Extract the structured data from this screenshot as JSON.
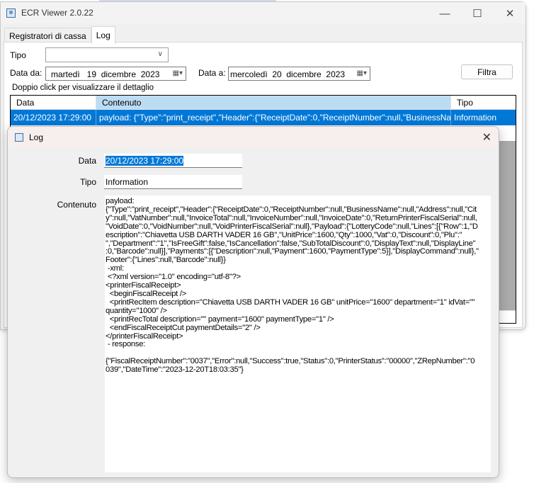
{
  "window": {
    "title": "ECR Viewer 2.0.22",
    "minimize": "—",
    "maximize": "☐",
    "close": "✕"
  },
  "tabs": [
    {
      "label": "Registratori di cassa"
    },
    {
      "label": "Log"
    }
  ],
  "filters": {
    "tipo_label": "Tipo",
    "tipo_value": "",
    "data_da_label": "Data da:",
    "data_da_value": "martedì   19  dicembre  2023",
    "data_a_label": "Data a:",
    "data_a_value": "mercoledì  20  dicembre  2023",
    "filter_button": "Filtra",
    "hint": "Doppio click per visualizzare il dettaglio"
  },
  "grid": {
    "columns": [
      "Data",
      "Contenuto",
      "Tipo"
    ],
    "rows": [
      {
        "data": "20/12/2023 17:29:00",
        "contenuto": "payload: {\"Type\":\"print_receipt\",\"Header\":{\"ReceiptDate\":0,\"ReceiptNumber\":null,\"BusinessName\":...",
        "tipo": "Information"
      }
    ]
  },
  "dialog": {
    "title": "Log",
    "close": "✕",
    "data_label": "Data",
    "data_value": "20/12/2023 17:29:00",
    "tipo_label": "Tipo",
    "tipo_value": "Information",
    "contenuto_label": "Contenuto",
    "contenuto_lines": [
      "payload:",
      "{\"Type\":\"print_receipt\",\"Header\":{\"ReceiptDate\":0,\"ReceiptNumber\":null,\"BusinessName\":null,\"Address\":null,\"Cit",
      "y\":null,\"VatNumber\":null,\"InvoiceTotal\":null,\"InvoiceNumber\":null,\"InvoiceDate\":0,\"ReturnPrinterFiscalSerial\":null,",
      "\"VoidDate\":0,\"VoidNumber\":null,\"VoidPrinterFiscalSerial\":null},\"Payload\":{\"LotteryCode\":null,\"Lines\":[{\"Row\":1,\"D",
      "escription\":\"Chiavetta USB DARTH VADER 16 GB\",\"UnitPrice\":1600,\"Qty\":1000,\"Vat\":0,\"Discount\":0,\"Plu\":\"",
      "\",\"Department\":\"1\",\"IsFreeGift\":false,\"IsCancellation\":false,\"SubTotalDiscount\":0,\"DisplayText\":null,\"DisplayLine\"",
      ":0,\"Barcode\":null}],\"Payments\":[{\"Description\":null,\"Payment\":1600,\"PaymentType\":5}],\"DisplayCommand\":null},\"",
      "Footer\":{\"Lines\":null,\"Barcode\":null}}",
      " -xml:",
      " <?xml version=\"1.0\" encoding=\"utf-8\"?>",
      "<printerFiscalReceipt>",
      "  <beginFiscalReceipt />",
      "  <printRecItem description=\"Chiavetta USB DARTH VADER 16 GB\" unitPrice=\"1600\" department=\"1\" idVat=\"\"",
      "quantity=\"1000\" />",
      "  <printRecTotal description=\"\" payment=\"1600\" paymentType=\"1\" />",
      "  <endFiscalReceiptCut paymentDetails=\"2\" />",
      "</printerFiscalReceipt>",
      " - response:",
      "",
      "{\"FiscalReceiptNumber\":\"0037\",\"Error\":null,\"Success\":true,\"Status\":0,\"PrinterStatus\":\"00000\",\"ZRepNumber\":\"0",
      "039\",\"DateTime\":\"2023-12-20T18:03:35\"}"
    ]
  }
}
